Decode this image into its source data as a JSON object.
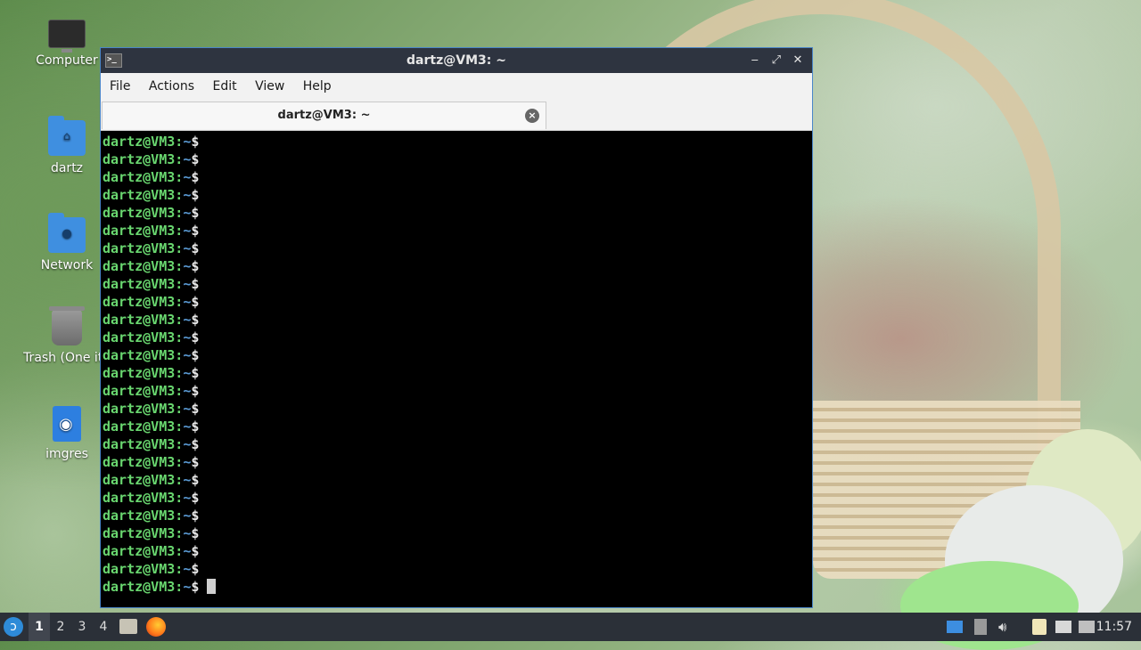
{
  "desktop": {
    "icons": [
      {
        "label": "Computer",
        "icon": "computer-icon"
      },
      {
        "label": "dartz",
        "icon": "home-folder-icon"
      },
      {
        "label": "Network",
        "icon": "network-folder-icon"
      },
      {
        "label": "Trash (One ite",
        "icon": "trash-icon"
      },
      {
        "label": "imgres",
        "icon": "web-file-icon"
      }
    ]
  },
  "window": {
    "title": "dartz@VM3: ~",
    "menu": [
      "File",
      "Actions",
      "Edit",
      "View",
      "Help"
    ],
    "tab_label": "dartz@VM3: ~",
    "controls": {
      "minimize": "‒",
      "maximize": "⤢",
      "close": "✕"
    }
  },
  "terminal": {
    "prompt_user": "dartz@VM3",
    "prompt_sep": ":",
    "prompt_path": "~",
    "prompt_symbol": "$",
    "line_count": 26,
    "colors": {
      "user": "#69d66f",
      "path": "#5b9bd5",
      "background": "#000000"
    }
  },
  "taskbar": {
    "workspaces": [
      "1",
      "2",
      "3",
      "4"
    ],
    "active_workspace": "1",
    "clock": "11:57",
    "tray_icons": [
      "window-icon",
      "clipboard-icon",
      "volume-icon",
      "battery-icon",
      "display-icon",
      "notification-icon"
    ]
  }
}
